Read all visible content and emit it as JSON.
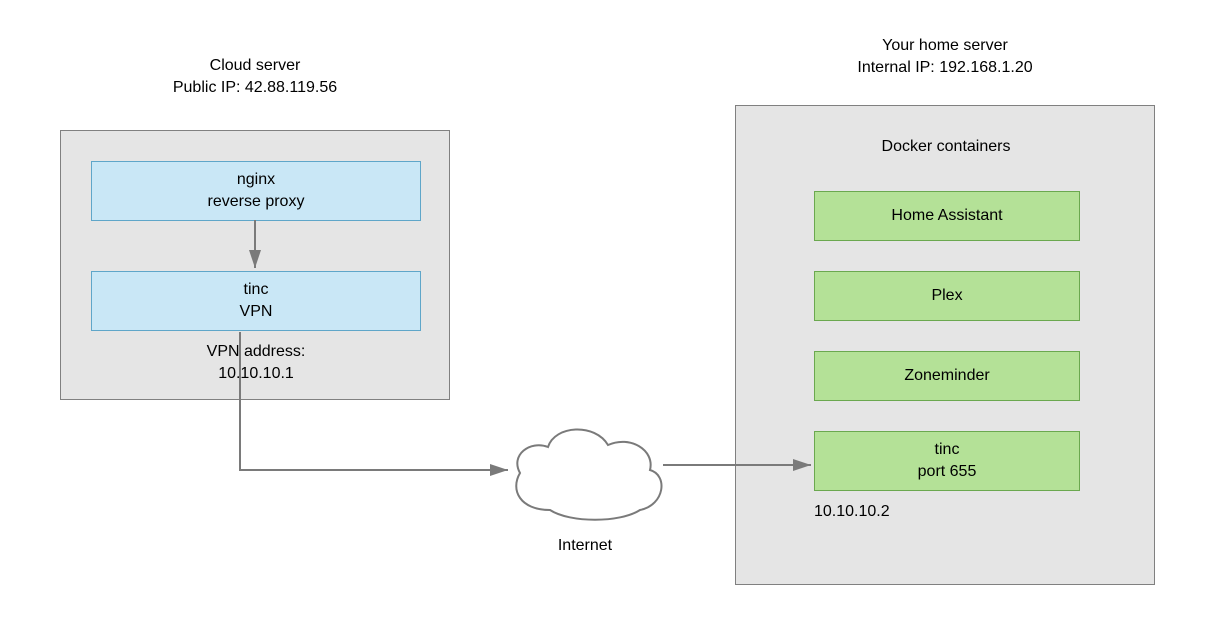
{
  "cloud_server": {
    "title": "Cloud server",
    "subtitle": "Public IP: 42.88.119.56",
    "nginx": {
      "line1": "nginx",
      "line2": "reverse proxy"
    },
    "tinc": {
      "line1": "tinc",
      "line2": "VPN"
    },
    "vpn_label_line1": "VPN address:",
    "vpn_label_line2": "10.10.10.1"
  },
  "home_server": {
    "title": "Your home server",
    "subtitle": "Internal IP: 192.168.1.20",
    "docker_header": "Docker containers",
    "containers": [
      {
        "label": "Home Assistant"
      },
      {
        "label": "Plex"
      },
      {
        "label": "Zoneminder"
      },
      {
        "line1": "tinc",
        "line2": "port 655"
      }
    ],
    "tinc_ip": "10.10.10.2"
  },
  "internet": "Internet"
}
